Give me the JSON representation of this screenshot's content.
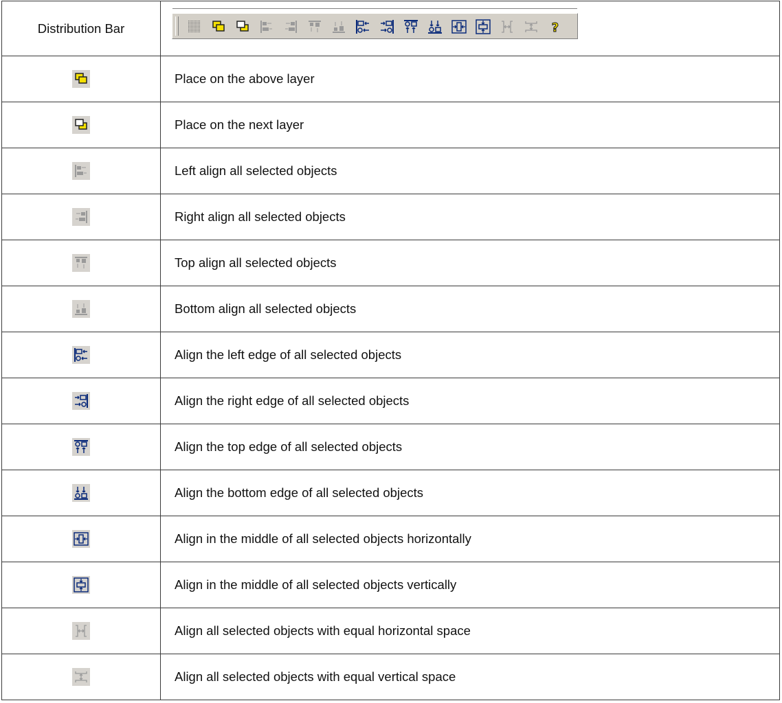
{
  "header": {
    "label": "Distribution Bar",
    "toolbar_icons": [
      "grid-icon",
      "bring-forward-icon",
      "send-backward-icon",
      "align-left-icon",
      "align-right-icon",
      "align-top-icon",
      "align-bottom-icon",
      "align-left-edge-icon",
      "align-right-edge-icon",
      "align-top-edge-icon",
      "align-bottom-edge-icon",
      "center-horizontal-icon",
      "center-vertical-icon",
      "space-horizontal-icon",
      "space-vertical-icon",
      "help-icon"
    ]
  },
  "rows": [
    {
      "icon": "bring-forward-icon",
      "text": "Place on the above layer"
    },
    {
      "icon": "send-backward-icon",
      "text": "Place on the next layer"
    },
    {
      "icon": "align-left-icon",
      "text": "Left align all selected objects"
    },
    {
      "icon": "align-right-icon",
      "text": "Right align all selected objects"
    },
    {
      "icon": "align-top-icon",
      "text": "Top align all selected objects"
    },
    {
      "icon": "align-bottom-icon",
      "text": "Bottom align all selected objects"
    },
    {
      "icon": "align-left-edge-icon",
      "text": "Align the left edge of all selected objects"
    },
    {
      "icon": "align-right-edge-icon",
      "text": "Align the right edge of all selected objects"
    },
    {
      "icon": "align-top-edge-icon",
      "text": "Align the top edge of all selected objects"
    },
    {
      "icon": "align-bottom-edge-icon",
      "text": "Align the bottom edge of all selected objects"
    },
    {
      "icon": "center-horizontal-icon",
      "text": "Align in the middle of all selected objects horizontally"
    },
    {
      "icon": "center-vertical-icon",
      "text": "Align in the middle of all selected objects vertically"
    },
    {
      "icon": "space-horizontal-icon",
      "text": "Align all selected objects with equal horizontal space"
    },
    {
      "icon": "space-vertical-icon",
      "text": "Align all selected objects with equal vertical space"
    }
  ],
  "colors": {
    "toolbar_bg": "#d4d0c8",
    "icon_yellow": "#f5e000",
    "icon_navy": "#0a2a7a",
    "icon_disabled": "#9a9a9a"
  }
}
